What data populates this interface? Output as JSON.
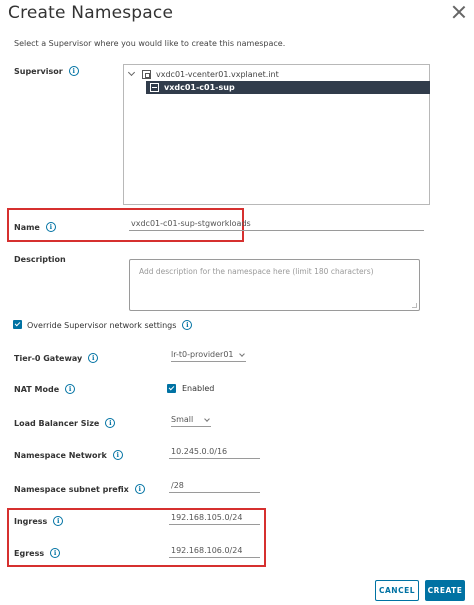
{
  "dialog": {
    "title": "Create Namespace",
    "subtitle": "Select a Supervisor where you would like to create this namespace."
  },
  "supervisor": {
    "label": "Supervisor",
    "tree": {
      "root": "vxdc01-vcenter01.vxplanet.int",
      "selected": "vxdc01-c01-sup"
    }
  },
  "name": {
    "label": "Name",
    "value": "vxdc01-c01-sup-stgworkloads"
  },
  "description": {
    "label": "Description",
    "placeholder": "Add description for the namespace here (limit 180 characters)"
  },
  "override": {
    "label": "Override Supervisor network settings",
    "checked": true
  },
  "tier0": {
    "label": "Tier-0 Gateway",
    "value": "lr-t0-provider01"
  },
  "nat": {
    "label": "NAT Mode",
    "checkbox_label": "Enabled",
    "checked": true
  },
  "lb_size": {
    "label": "Load Balancer Size",
    "value": "Small"
  },
  "ns_network": {
    "label": "Namespace Network",
    "value": "10.245.0.0/16"
  },
  "subnet_prefix": {
    "label": "Namespace subnet prefix",
    "value": "/28"
  },
  "ingress": {
    "label": "Ingress",
    "value": "192.168.105.0/24"
  },
  "egress": {
    "label": "Egress",
    "value": "192.168.106.0/24"
  },
  "buttons": {
    "cancel": "CANCEL",
    "create": "CREATE"
  },
  "colors": {
    "accent": "#0072a3",
    "highlight": "#d6302f",
    "selected_row": "#313c4b"
  },
  "icons": {
    "info": "i"
  }
}
